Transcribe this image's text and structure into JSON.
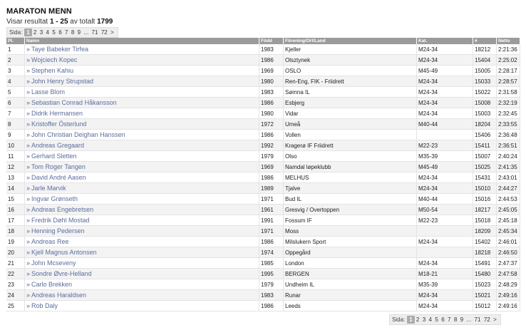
{
  "page_title": "MARATON MENN",
  "summary": {
    "prefix": "Visar resultat ",
    "range": "1 - 25",
    "middle": " av totalt ",
    "total": "1799"
  },
  "pager": {
    "label": "Sida:",
    "pages": [
      "1",
      "2",
      "3",
      "4",
      "5",
      "6",
      "7",
      "8",
      "9",
      "...",
      "71",
      "72",
      ">"
    ],
    "current": "1"
  },
  "table": {
    "headers": [
      "Pl.",
      "Namn",
      "Född",
      "Förening/Ort/Land",
      "Kat.",
      "#",
      "Netto"
    ],
    "rows": [
      {
        "pl": "1",
        "name": "Taye Babeker Tirfea",
        "born": "1983",
        "club": "Kjeller",
        "cat": "M24-34",
        "nr": "18212",
        "net": "2:21:36"
      },
      {
        "pl": "2",
        "name": "Wojciech Kopec",
        "born": "1986",
        "club": "Olsztynek",
        "cat": "M24-34",
        "nr": "15404",
        "net": "2:25:02"
      },
      {
        "pl": "3",
        "name": "Stephen Kahiu",
        "born": "1969",
        "club": "OSLO",
        "cat": "M45-49",
        "nr": "15005",
        "net": "2:28:17"
      },
      {
        "pl": "4",
        "name": "John Henry Strupstad",
        "born": "1980",
        "club": "Ren-Eng, FIK - Friidrett",
        "cat": "M24-34",
        "nr": "15033",
        "net": "2:28:57"
      },
      {
        "pl": "5",
        "name": "Lasse Blom",
        "born": "1983",
        "club": "Sømna IL",
        "cat": "M24-34",
        "nr": "15022",
        "net": "2:31:58"
      },
      {
        "pl": "6",
        "name": "Sebastian Conrad Håkansson",
        "born": "1986",
        "club": "Esbjerg",
        "cat": "M24-34",
        "nr": "15008",
        "net": "2:32:19"
      },
      {
        "pl": "7",
        "name": "Didrik Hermansen",
        "born": "1980",
        "club": "Vidar",
        "cat": "M24-34",
        "nr": "15003",
        "net": "2:32:45"
      },
      {
        "pl": "8",
        "name": "Kristoffer Österlund",
        "born": "1972",
        "club": "Umeå",
        "cat": "M40-44",
        "nr": "18204",
        "net": "2:33:55"
      },
      {
        "pl": "9",
        "name": "John Christian Deighan Hanssen",
        "born": "1986",
        "club": "Vollen",
        "cat": "",
        "nr": "15406",
        "net": "2:36:48"
      },
      {
        "pl": "10",
        "name": "Andreas Gregaard",
        "born": "1992",
        "club": "Kragerø IF Friidrett",
        "cat": "M22-23",
        "nr": "15411",
        "net": "2:36:51"
      },
      {
        "pl": "11",
        "name": "Gerhard Sletten",
        "born": "1979",
        "club": "Olso",
        "cat": "M35-39",
        "nr": "15007",
        "net": "2:40:24"
      },
      {
        "pl": "12",
        "name": "Tom Roger Tangen",
        "born": "1969",
        "club": "Namdal løpeklubb",
        "cat": "M45-49",
        "nr": "15025",
        "net": "2:41:35"
      },
      {
        "pl": "13",
        "name": "David André Aasen",
        "born": "1986",
        "club": "MELHUS",
        "cat": "M24-34",
        "nr": "15431",
        "net": "2:43:01"
      },
      {
        "pl": "14",
        "name": "Jarle Marvik",
        "born": "1989",
        "club": "Tjalve",
        "cat": "M24-34",
        "nr": "15010",
        "net": "2:44:27"
      },
      {
        "pl": "15",
        "name": "Ingvar Grønseth",
        "born": "1971",
        "club": "Bud IL",
        "cat": "M40-44",
        "nr": "15016",
        "net": "2:44:53"
      },
      {
        "pl": "16",
        "name": "Andreas Engebretsen",
        "born": "1961",
        "club": "Gresvig / Overtoppen",
        "cat": "M50-54",
        "nr": "18217",
        "net": "2:45:05"
      },
      {
        "pl": "17",
        "name": "Fredrik Døhl Mostad",
        "born": "1991",
        "club": "Fossum IF",
        "cat": "M22-23",
        "nr": "15018",
        "net": "2:45:18"
      },
      {
        "pl": "18",
        "name": "Henning Pedersen",
        "born": "1971",
        "club": "Moss",
        "cat": "",
        "nr": "18209",
        "net": "2:45:34"
      },
      {
        "pl": "19",
        "name": "Andreas Ree",
        "born": "1986",
        "club": "Milslukern Sport",
        "cat": "M24-34",
        "nr": "15402",
        "net": "2:46:01"
      },
      {
        "pl": "20",
        "name": "Kjell Magnus Antonsen",
        "born": "1974",
        "club": "Oppegård",
        "cat": "",
        "nr": "18218",
        "net": "2:46:50"
      },
      {
        "pl": "21",
        "name": "John Mcseveny",
        "born": "1985",
        "club": "London",
        "cat": "M24-34",
        "nr": "15491",
        "net": "2:47:37"
      },
      {
        "pl": "22",
        "name": "Sondre Øvre-Helland",
        "born": "1995",
        "club": "BERGEN",
        "cat": "M18-21",
        "nr": "15480",
        "net": "2:47:58"
      },
      {
        "pl": "23",
        "name": "Carlo Brekken",
        "born": "1979",
        "club": "Undheim IL",
        "cat": "M35-39",
        "nr": "15023",
        "net": "2:48:29"
      },
      {
        "pl": "24",
        "name": "Andreas Haraldsen",
        "born": "1983",
        "club": "Runar",
        "cat": "M24-34",
        "nr": "15021",
        "net": "2:49:16"
      },
      {
        "pl": "25",
        "name": "Rob Daly",
        "born": "1986",
        "club": "Leeds",
        "cat": "M24-34",
        "nr": "15012",
        "net": "2:49:16"
      }
    ]
  },
  "colors": {
    "header_bg": "#9b9b9b",
    "link": "#5a6d9c",
    "row_alt": "#f3f3f3"
  }
}
